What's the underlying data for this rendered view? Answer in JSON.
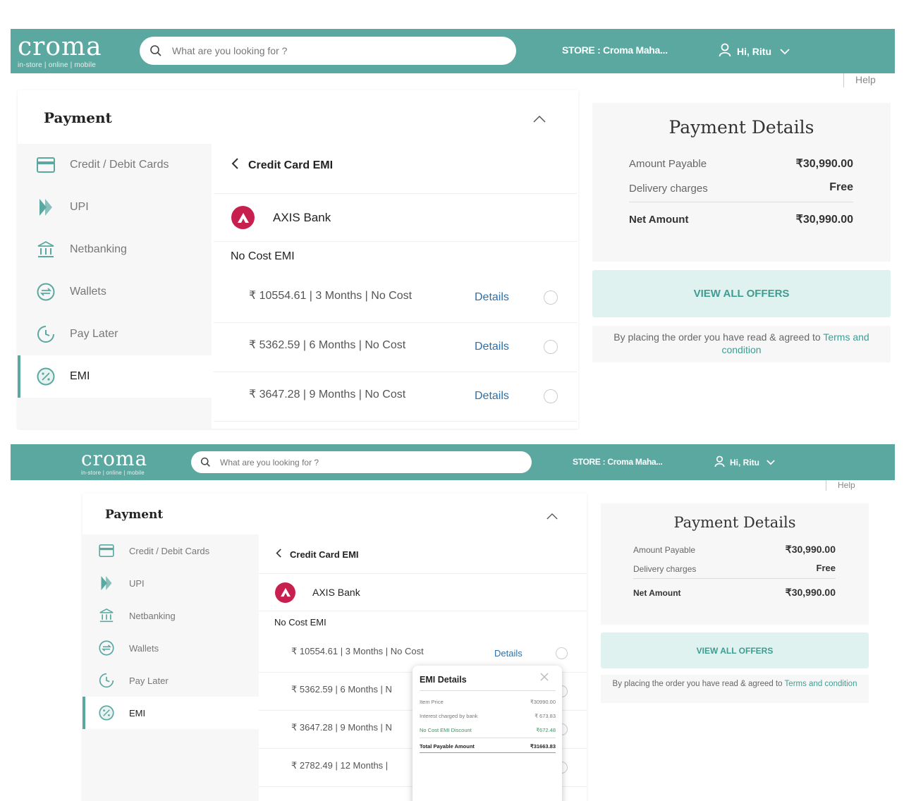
{
  "brand": {
    "name": "croma",
    "tagline": "in-store | online | mobile",
    "accent": "#5ba8a1",
    "link": "#2f6fa7",
    "emi_logo_color": "#c8204e"
  },
  "search": {
    "placeholder": "What are you looking for ?"
  },
  "store_label": "STORE : Croma Maha...",
  "user_greeting": "Hi, Ritu",
  "help_label": "Help",
  "payment": {
    "title": "Payment",
    "methods": [
      {
        "label": "Credit / Debit Cards",
        "icon": "card-icon"
      },
      {
        "label": "UPI",
        "icon": "upi-icon"
      },
      {
        "label": "Netbanking",
        "icon": "bank-icon"
      },
      {
        "label": "Wallets",
        "icon": "wallet-icon"
      },
      {
        "label": "Pay Later",
        "icon": "clock-icon"
      },
      {
        "label": "EMI",
        "icon": "percent-icon",
        "active": true
      }
    ],
    "emi_header": "Credit Card EMI",
    "bank": "AXIS Bank",
    "section": "No Cost EMI",
    "plans": [
      {
        "label": "₹ 10554.61 | 3 Months | No Cost",
        "truncated": "₹ 10554.61 | 3 Months | No Cost"
      },
      {
        "label": "₹ 5362.59 | 6 Months | No Cost",
        "truncated": "₹ 5362.59 | 6 Months | N"
      },
      {
        "label": "₹ 3647.28 | 9 Months | No Cost",
        "truncated": "₹ 3647.28 | 9 Months | N"
      },
      {
        "label": "₹ 2782.49 | 12 Months |",
        "truncated": "₹ 2782.49 | 12 Months |"
      }
    ],
    "details_label": "Details"
  },
  "payment_details": {
    "title": "Payment Details",
    "amount_payable_label": "Amount Payable",
    "amount_payable": "₹30,990.00",
    "delivery_label": "Delivery charges",
    "delivery": "Free",
    "net_label": "Net Amount",
    "net": "₹30,990.00"
  },
  "offers_label": "VIEW ALL OFFERS",
  "terms": {
    "text": "By placing the order you have read & agreed to ",
    "link": "Terms and condition"
  },
  "emi_modal": {
    "title": "EMI Details",
    "rows": [
      {
        "label": "Item Price",
        "value": "₹30990.00"
      },
      {
        "label": "Interest charged by bank",
        "value": "₹ 673.83"
      },
      {
        "label": "No Cost EMI Discount",
        "value": "₹672.48"
      }
    ],
    "total_label": "Total Payable Amount",
    "total": "₹31663.83"
  }
}
